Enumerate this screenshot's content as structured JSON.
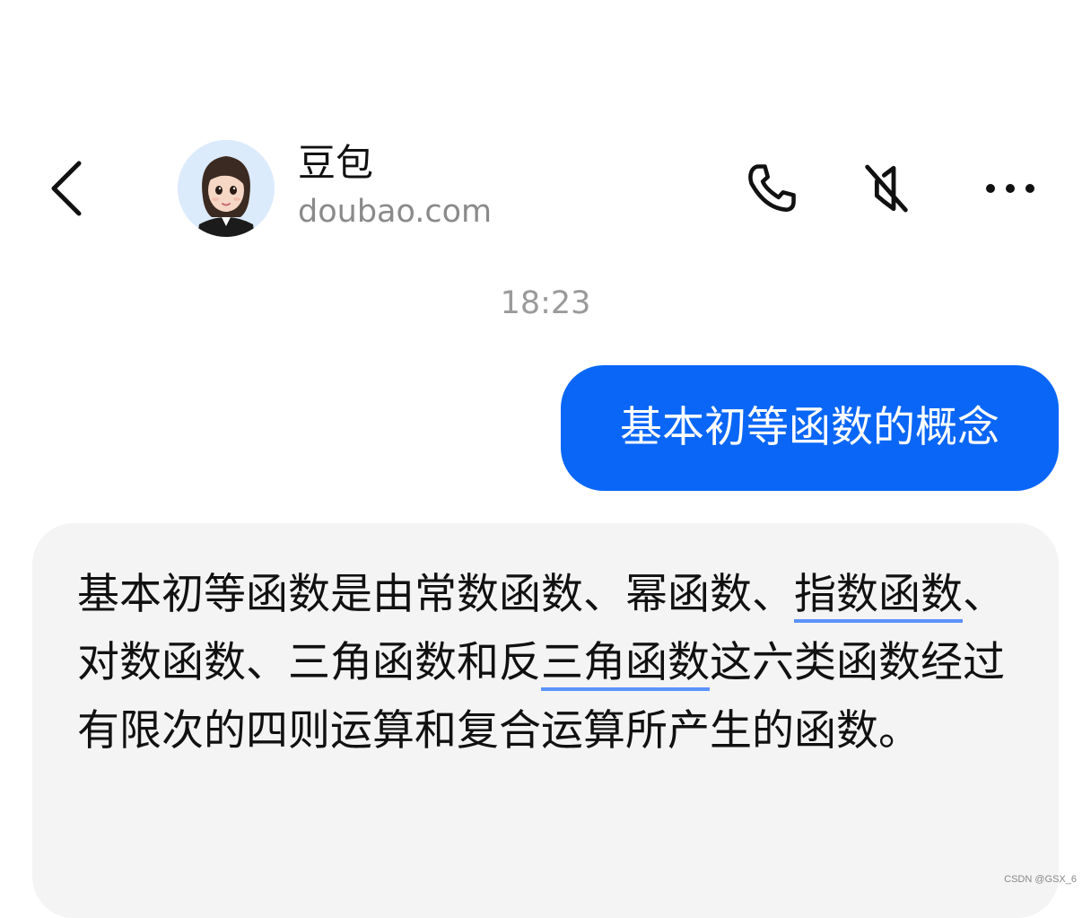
{
  "header": {
    "contact_name": "豆包",
    "contact_subtitle": "doubao.com",
    "icons": {
      "back": "chevron-left-icon",
      "call": "phone-icon",
      "mute": "speaker-muted-icon",
      "more": "more-horizontal-icon"
    }
  },
  "chat": {
    "timestamp": "18:23",
    "user_message": "基本初等函数的概念",
    "bot_message": {
      "seg1": "基本初等函数是由常数函数、幂函数、",
      "kw1": "指数函数",
      "seg2": "、对数函数、三角函数和反",
      "kw2": "三角函数",
      "seg3": "这六类函数经过有限次的四则运算和复合运算所产生的函数。"
    }
  },
  "watermark": "CSDN @GSX_6",
  "colors": {
    "user_bubble": "#0a66f6",
    "bot_bubble": "#f4f4f4",
    "keyword_underline": "#5c93ff",
    "timestamp": "#9a9a9a"
  }
}
